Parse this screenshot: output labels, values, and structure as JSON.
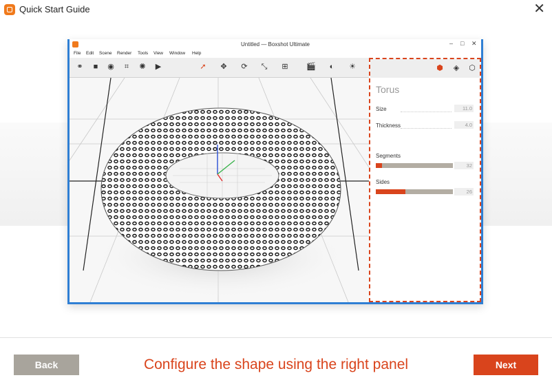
{
  "dialog": {
    "title": "Quick Start Guide",
    "close_label": "✕",
    "caption": "Configure the shape using the right panel",
    "back_label": "Back",
    "next_label": "Next",
    "accent_color": "#d9441c"
  },
  "app_window": {
    "title": "Untitled — Boxshot Ultimate",
    "menu": [
      "File",
      "Edit",
      "Scene",
      "Render",
      "Tools",
      "View",
      "Window",
      "Help"
    ]
  },
  "panel": {
    "title": "Torus",
    "size": {
      "label": "Size",
      "value": "11.0"
    },
    "thickness": {
      "label": "Thickness",
      "value": "4.0"
    },
    "segments": {
      "label": "Segments",
      "value": "32",
      "fill": 0.08
    },
    "sides": {
      "label": "Sides",
      "value": "26",
      "fill": 0.38
    }
  }
}
